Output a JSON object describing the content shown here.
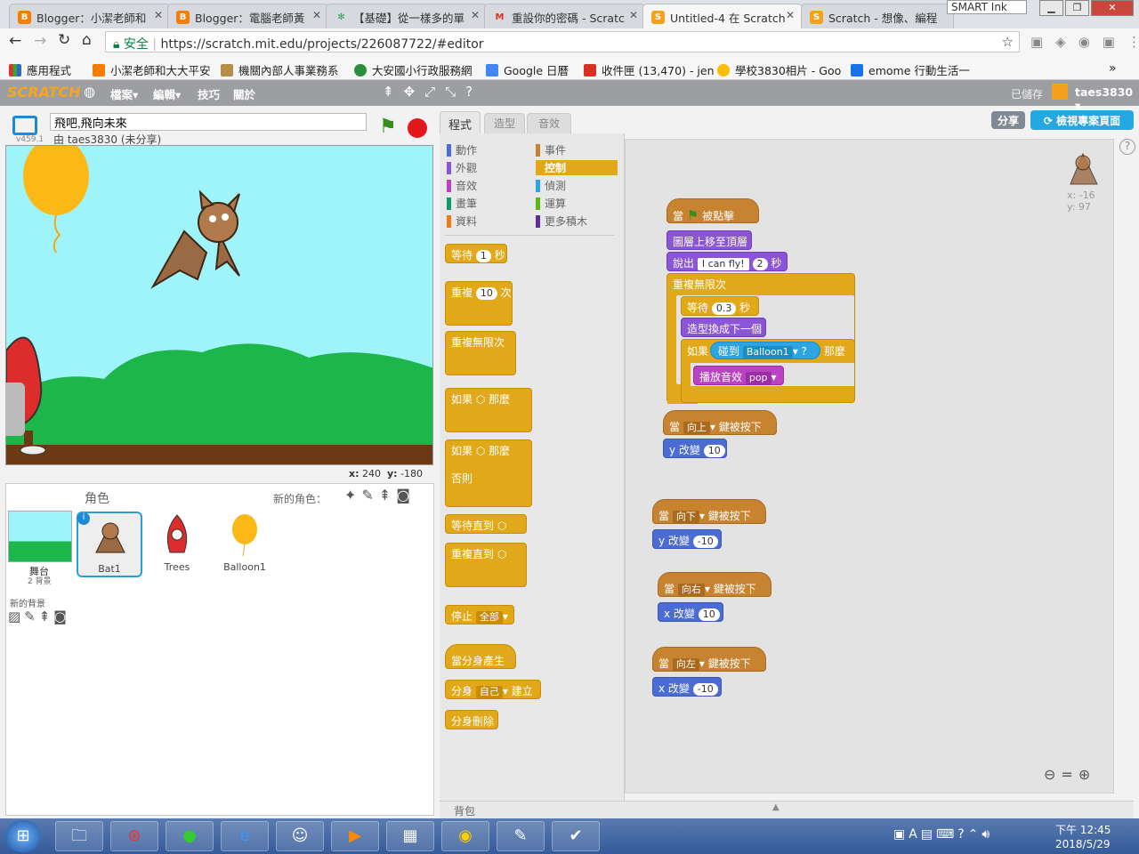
{
  "browser": {
    "tabs": [
      {
        "title": "Blogger：小潔老師和",
        "color": "#f57d00",
        "glyph": "B"
      },
      {
        "title": "Blogger：電腦老師黃",
        "color": "#f57d00",
        "glyph": "B"
      },
      {
        "title": "【基礎】從一樣多的單",
        "color": "#2e9e5b",
        "glyph": "✻"
      },
      {
        "title": "重設你的密碼 - Scratc",
        "color": "#d93025",
        "glyph": "M"
      },
      {
        "title": "Untitled-4 在 Scratch",
        "color": "#f4a21c",
        "glyph": "S"
      },
      {
        "title": "Scratch - 想像、編程",
        "color": "#f4a21c",
        "glyph": "S"
      }
    ],
    "smart_ink": "SMART Ink",
    "secure_label": "安全",
    "url": "https://scratch.mit.edu/projects/226087722/#editor",
    "bookmarks": [
      "應用程式",
      "小潔老師和大大平安",
      "機關內部人事業務系",
      "大安國小行政服務網",
      "Google 日曆",
      "收件匣 (13,470) - jen",
      "學校3830相片 - Goo",
      "emome 行動生活一"
    ]
  },
  "scratch": {
    "logo": "SCRATCH",
    "menus": [
      "檔案▾",
      "編輯▾",
      "技巧",
      "關於"
    ],
    "saved": "已儲存",
    "user": "taes3830 ▾",
    "version": "v459.1",
    "project_title": "飛吧,飛向未來",
    "by_line": "由 taes3830 (未分享)",
    "stage_x_label": "x:",
    "stage_x": "240",
    "stage_y_label": "y:",
    "stage_y": "-180",
    "tabs": [
      "程式",
      "造型",
      "音效"
    ],
    "share_button": "分享",
    "see_project_button": "檢視專案頁面",
    "sprites_header": "角色",
    "new_sprite_label": "新的角色：",
    "stage_thumb_label": "舞台",
    "stage_backdrops": "2 背景",
    "new_backdrop_label": "新的背景",
    "sprites": [
      {
        "name": "Bat1"
      },
      {
        "name": "Trees"
      },
      {
        "name": "Balloon1"
      }
    ],
    "categories_left": [
      {
        "name": "動作",
        "color": "#4a6cd4"
      },
      {
        "name": "外觀",
        "color": "#8a55d7"
      },
      {
        "name": "音效",
        "color": "#bb42c3"
      },
      {
        "name": "畫筆",
        "color": "#0e9a6c"
      },
      {
        "name": "資料",
        "color": "#ee7d16"
      }
    ],
    "categories_right": [
      {
        "name": "事件",
        "color": "#c88330"
      },
      {
        "name": "控制",
        "color": "#e1a91a"
      },
      {
        "name": "偵測",
        "color": "#2ca5e2"
      },
      {
        "name": "運算",
        "color": "#5cb712"
      },
      {
        "name": "更多積木",
        "color": "#632d99"
      }
    ],
    "palette": {
      "wait": "等待",
      "wait_num": "1",
      "sec": "秒",
      "repeat": "重複",
      "repeat_num": "10",
      "times": "次",
      "forever": "重複無限次",
      "if": "如果",
      "then": "那麼",
      "else": "否則",
      "wait_until": "等待直到",
      "repeat_until": "重複直到",
      "stop": "停止",
      "stop_opt": "全部",
      "clone_start": "當分身產生",
      "clone": "分身",
      "clone_opt": "自己",
      "clone_create": "建立",
      "clone_delete": "分身刪除"
    },
    "sprite_info": {
      "x_label": "x:",
      "x": "-16",
      "y_label": "y:",
      "y": "97"
    },
    "script": {
      "when": "當",
      "clicked": "被點擊",
      "front": "圖層上移至頂層",
      "say": "說出",
      "say_text": "I can fly!",
      "say_num": "2",
      "secs": "秒",
      "forever": "重複無限次",
      "wait": "等待",
      "wait_num": "0.3",
      "next": "造型換成下一個",
      "if": "如果",
      "touching": "碰到",
      "touch_target": "Balloon1",
      "q": "?",
      "then": "那麼",
      "play": "播放音效",
      "sound": "pop",
      "key_pressed": "鍵被按下",
      "up": "向上",
      "down": "向下",
      "right": "向右",
      "left": "向左",
      "y_change": "y 改變",
      "x_change": "x 改變",
      "v10": "10",
      "vm10": "-10"
    },
    "backpack": "背包"
  },
  "taskbar": {
    "time": "下午 12:45",
    "date": "2018/5/29"
  }
}
